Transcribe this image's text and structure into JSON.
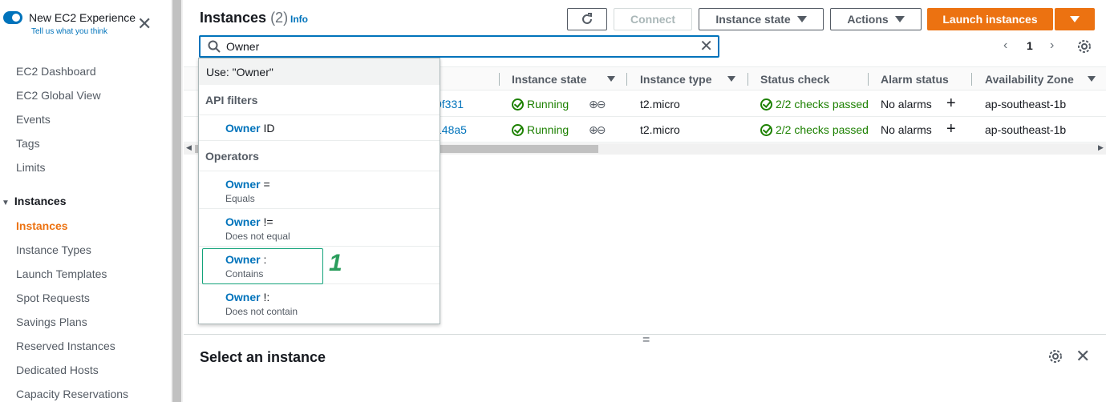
{
  "sidebar": {
    "toggle_title": "New EC2 Experience",
    "toggle_sub": "Tell us what you think",
    "items": [
      "EC2 Dashboard",
      "EC2 Global View",
      "Events",
      "Tags",
      "Limits"
    ],
    "section": "Instances",
    "section_items": [
      "Instances",
      "Instance Types",
      "Launch Templates",
      "Spot Requests",
      "Savings Plans",
      "Reserved Instances",
      "Dedicated Hosts",
      "Capacity Reservations"
    ],
    "active_item": "Instances"
  },
  "header": {
    "title": "Instances",
    "count": "(2)",
    "info": "Info",
    "connect_label": "Connect",
    "instance_state_label": "Instance state",
    "actions_label": "Actions",
    "launch_label": "Launch instances"
  },
  "search": {
    "value": "Owner"
  },
  "pagination": {
    "page": "1"
  },
  "table": {
    "columns": [
      "Instance state",
      "Instance type",
      "Status check",
      "Alarm status",
      "Availability Zone"
    ],
    "rows": [
      {
        "id_suffix": "0f331",
        "state": "Running",
        "type": "t2.micro",
        "status": "2/2 checks passed",
        "alarm": "No alarms",
        "az": "ap-southeast-1b"
      },
      {
        "id_suffix": "148a5",
        "state": "Running",
        "type": "t2.micro",
        "status": "2/2 checks passed",
        "alarm": "No alarms",
        "az": "ap-southeast-1b"
      }
    ]
  },
  "dropdown": {
    "use_label": "Use: \"Owner\"",
    "api_filters_header": "API filters",
    "api_filter": {
      "bold": "Owner",
      "rest": " ID"
    },
    "operators_header": "Operators",
    "operators": [
      {
        "bold": "Owner",
        "op": " =",
        "desc": "Equals"
      },
      {
        "bold": "Owner",
        "op": " !=",
        "desc": "Does not equal"
      },
      {
        "bold": "Owner",
        "op": " :",
        "desc": "Contains"
      },
      {
        "bold": "Owner",
        "op": " !:",
        "desc": "Does not contain"
      }
    ]
  },
  "annotation": "1",
  "split": {
    "title": "Select an instance"
  },
  "colors": {
    "accent": "#0073bb",
    "primary": "#ec7211",
    "success": "#1d8102"
  }
}
